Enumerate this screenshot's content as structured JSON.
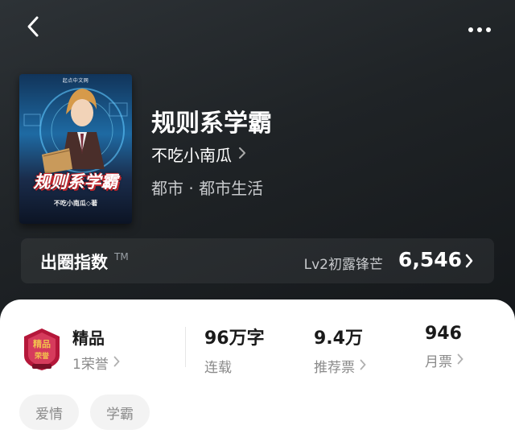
{
  "book": {
    "title": "规则系学霸",
    "author": "不吃小南瓜",
    "genre": "都市 · 都市生活",
    "cover": {
      "publisher": "起点中文网",
      "title": "规则系学霸",
      "author_credit": "不吃小南瓜◇著"
    }
  },
  "popularity": {
    "label": "出圈指数",
    "tm": "TM",
    "level": "Lv2初露锋芒",
    "value": "6,546"
  },
  "honor": {
    "title": "精品",
    "subtitle": "1荣誉",
    "badge_icon": "premium-badge-icon"
  },
  "stats": [
    {
      "value": "96万字",
      "label": "连载",
      "has_chevron": false
    },
    {
      "value": "9.4万",
      "label": "推荐票",
      "has_chevron": true
    },
    {
      "value": "946",
      "label": "月票",
      "has_chevron": true
    }
  ],
  "tags": [
    "爱情",
    "学霸"
  ],
  "icons": {
    "back": "chevron-left-icon",
    "more": "more-dots-icon"
  },
  "colors": {
    "hero_bg": "#1f2326",
    "badge_red": "#b5173a",
    "badge_gold": "#f2c14e"
  }
}
